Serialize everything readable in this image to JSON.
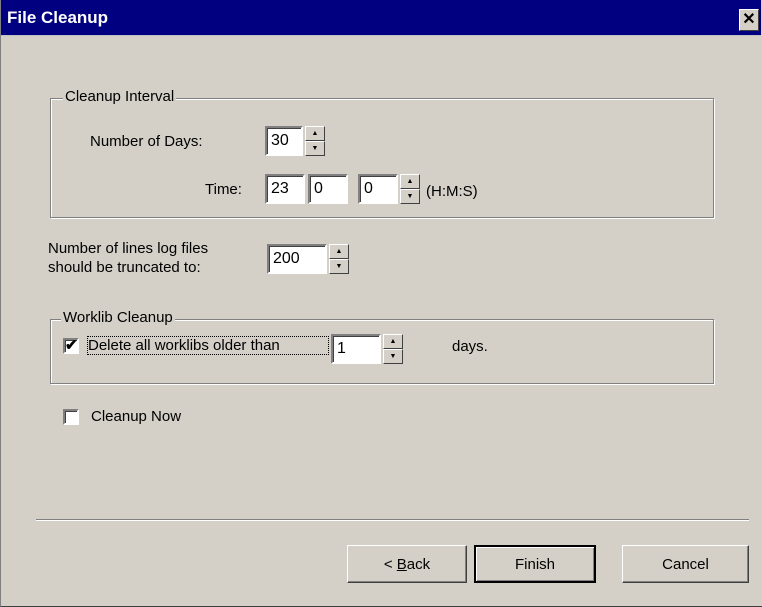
{
  "window": {
    "title": "File Cleanup",
    "close_glyph": "✕"
  },
  "cleanup_interval": {
    "group_title": "Cleanup Interval",
    "days_label": "Number of Days:",
    "days_value": "30",
    "time_label": "Time:",
    "hours_value": "23",
    "minutes_value": "0",
    "seconds_value": "0",
    "time_format_label": "(H:M:S)"
  },
  "log_truncate": {
    "label_line1": "Number of lines log files",
    "label_line2": "should be truncated to:",
    "value": "200"
  },
  "worklib_cleanup": {
    "group_title": "Worklib Cleanup",
    "delete_label": "Delete all worklibs older than",
    "delete_checked": true,
    "days_value": "1",
    "days_suffix": "days."
  },
  "cleanup_now": {
    "label": "Cleanup Now",
    "checked": false
  },
  "buttons": {
    "back_prefix": "< ",
    "back_mnemonic": "B",
    "back_rest": "ack",
    "finish": "Finish",
    "cancel": "Cancel"
  },
  "icons": {
    "check_mark": "✔",
    "spin_up": "▲",
    "spin_down": "▼"
  }
}
